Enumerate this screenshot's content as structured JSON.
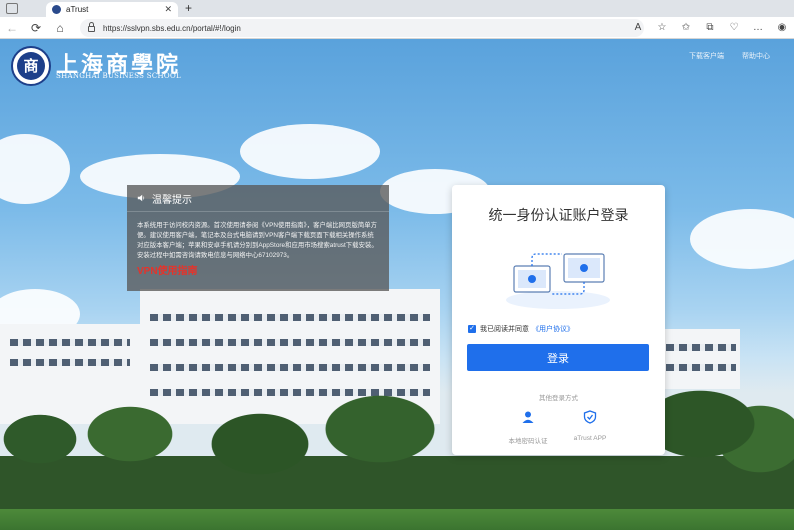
{
  "browser": {
    "tab_title": "aTrust",
    "tab_close": "✕",
    "new_tab": "+",
    "url": "https://sslvpn.sbs.edu.cn/portal/#!/login",
    "nav": {
      "back": "←",
      "reload": "⟳",
      "home": "⌂"
    },
    "toolbar_icons": [
      "A",
      "☆",
      "✩",
      "⧉",
      "♡",
      "…",
      "◉"
    ]
  },
  "header": {
    "seal_text": "商",
    "school_name_cn": "上海商學院",
    "school_name_en": "SHANGHAI BUSINESS SCHOOL",
    "links": [
      "下载客户端",
      "帮助中心"
    ]
  },
  "notice": {
    "title": "温馨提示",
    "body": "本系统用于访问校内资源。首次使用请参阅《VPN使用指南》，客户端比网页版简单方便。建议使用客户端，笔记本及台式电脑请到VPN客户端下载页面下载相关操作系统对应版本客户端；苹果和安卓手机请分别到AppStore和应用市场搜索atrust下载安装。安装过程中如需咨询请致电信息与网络中心67102973。",
    "link": "VPN使用指南"
  },
  "login": {
    "title": "统一身份认证账户登录",
    "agree_text": "我已阅读并同意",
    "agree_link": "《用户协议》",
    "button": "登录",
    "other_methods": "其他登录方式",
    "alt1": "本地密码认证",
    "alt2": "aTrust APP"
  },
  "colors": {
    "accent": "#1f6feb",
    "notice_link": "#e3342c"
  }
}
